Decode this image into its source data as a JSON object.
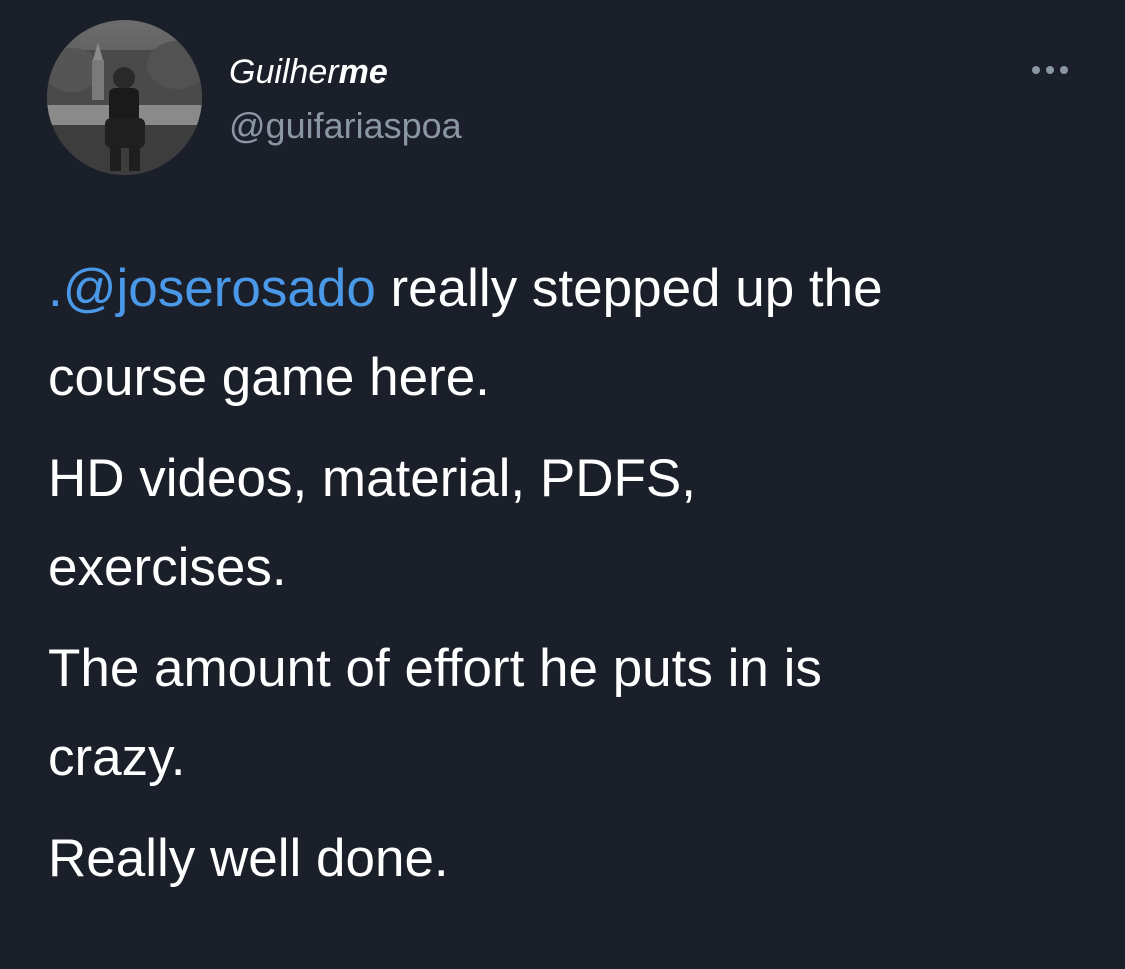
{
  "author": {
    "name_first": "Guilher",
    "name_second": "me",
    "handle": "@guifariaspoa",
    "avatar_icon": "profile-photo"
  },
  "menu": {
    "icon": "more-dots-icon"
  },
  "tweet": {
    "mention": ".@joserosado",
    "line1_rest": " really stepped up the",
    "line2": "course game here.",
    "para2_line1": "HD videos, material, PDFS,",
    "para2_line2": "exercises.",
    "para3_line1": "The amount of effort he puts in is",
    "para3_line2": "crazy.",
    "para4": "Really well done."
  },
  "colors": {
    "background": "#1b1f29",
    "text": "#ffffff",
    "handle": "#8b96a3",
    "mention": "#4a99e9"
  }
}
